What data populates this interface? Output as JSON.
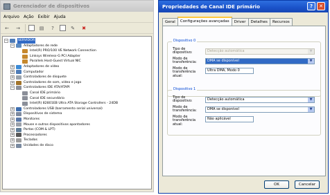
{
  "device_manager": {
    "title": "Gerenciador de dispositivos",
    "menu": [
      "Arquivo",
      "Ação",
      "Exibir",
      "Ajuda"
    ],
    "toolbar_icons": [
      "back-icon",
      "forward-icon",
      "properties-icon",
      "print-icon",
      "help-icon",
      "scan-icon",
      "uninstall-icon",
      "disable-icon"
    ],
    "tree": [
      {
        "label": "SERVIDOR",
        "level": 0,
        "expander": "−",
        "icon": "computer-icon",
        "selected": true
      },
      {
        "label": "Adaptadores de rede",
        "level": 1,
        "expander": "−",
        "icon": "network-icon"
      },
      {
        "label": "Intel(R) PRO/100 VE Network Connection",
        "level": 2,
        "expander": "",
        "icon": "network-card-icon"
      },
      {
        "label": "Linksys Wireless-G PCI Adapter",
        "level": 2,
        "expander": "",
        "icon": "network-card-icon"
      },
      {
        "label": "Parallels Host-Guest Virtual NIC",
        "level": 2,
        "expander": "",
        "icon": "network-card-icon"
      },
      {
        "label": "Adaptadores de vídeo",
        "level": 1,
        "expander": "+",
        "icon": "display-adapter-icon"
      },
      {
        "label": "Computador",
        "level": 1,
        "expander": "+",
        "icon": "computer-icon"
      },
      {
        "label": "Controladores de disquete",
        "level": 1,
        "expander": "+",
        "icon": "floppy-icon"
      },
      {
        "label": "Controladores de som, vídeo e jogo",
        "level": 1,
        "expander": "+",
        "icon": "sound-icon"
      },
      {
        "label": "Controladores IDE ATA/ATAPI",
        "level": 1,
        "expander": "−",
        "icon": "ide-icon"
      },
      {
        "label": "Canal IDE primário",
        "level": 2,
        "expander": "",
        "icon": "ide-channel-icon"
      },
      {
        "label": "Canal IDE secundário",
        "level": 2,
        "expander": "",
        "icon": "ide-channel-icon"
      },
      {
        "label": "Intel(R) 82801EB Ultra ATA Storage Controllers - 24DB",
        "level": 2,
        "expander": "",
        "icon": "ide-channel-icon"
      },
      {
        "label": "Controladores USB (barramento serial universal)",
        "level": 1,
        "expander": "+",
        "icon": "usb-icon"
      },
      {
        "label": "Dispositivos de sistema",
        "level": 1,
        "expander": "+",
        "icon": "system-icon"
      },
      {
        "label": "Monitores",
        "level": 1,
        "expander": "+",
        "icon": "monitor-icon"
      },
      {
        "label": "Mouse e outros dispositivos apontadores",
        "level": 1,
        "expander": "+",
        "icon": "mouse-icon"
      },
      {
        "label": "Portas (COM & LPT)",
        "level": 1,
        "expander": "+",
        "icon": "port-icon"
      },
      {
        "label": "Processadores",
        "level": 1,
        "expander": "+",
        "icon": "cpu-icon"
      },
      {
        "label": "Teclados",
        "level": 1,
        "expander": "+",
        "icon": "keyboard-icon"
      },
      {
        "label": "Unidades de disco",
        "level": 1,
        "expander": "+",
        "icon": "disk-drive-icon"
      }
    ]
  },
  "properties_dialog": {
    "title": "Propriedades de Canal IDE primário",
    "help_button": "?",
    "close_button": "✕",
    "tabs": [
      {
        "label": "Geral",
        "active": false
      },
      {
        "label": "Configurações avançadas",
        "active": true
      },
      {
        "label": "Driver",
        "active": false
      },
      {
        "label": "Detalhes",
        "active": false
      },
      {
        "label": "Recursos",
        "active": false
      }
    ],
    "device0": {
      "group_label": "Dispositivo 0",
      "device_type_label": "Tipo de dispositivo:",
      "device_type_value": "Detecção automática",
      "transfer_mode_label": "Modo de transferência:",
      "transfer_mode_value": "DMA se disponível",
      "current_mode_label": "Modo de transferência atual:",
      "current_mode_value": "Ultra DMA, Modo 0"
    },
    "device1": {
      "group_label": "Dispositivo 1",
      "device_type_label": "Tipo de dispositivo:",
      "device_type_value": "Detecção automática",
      "transfer_mode_label": "Modo de transferência:",
      "transfer_mode_value": "DMA se disponível",
      "current_mode_label": "Modo de transferência atual:",
      "current_mode_value": "Não aplicável"
    },
    "ok_label": "OK",
    "cancel_label": "Cancelar"
  }
}
